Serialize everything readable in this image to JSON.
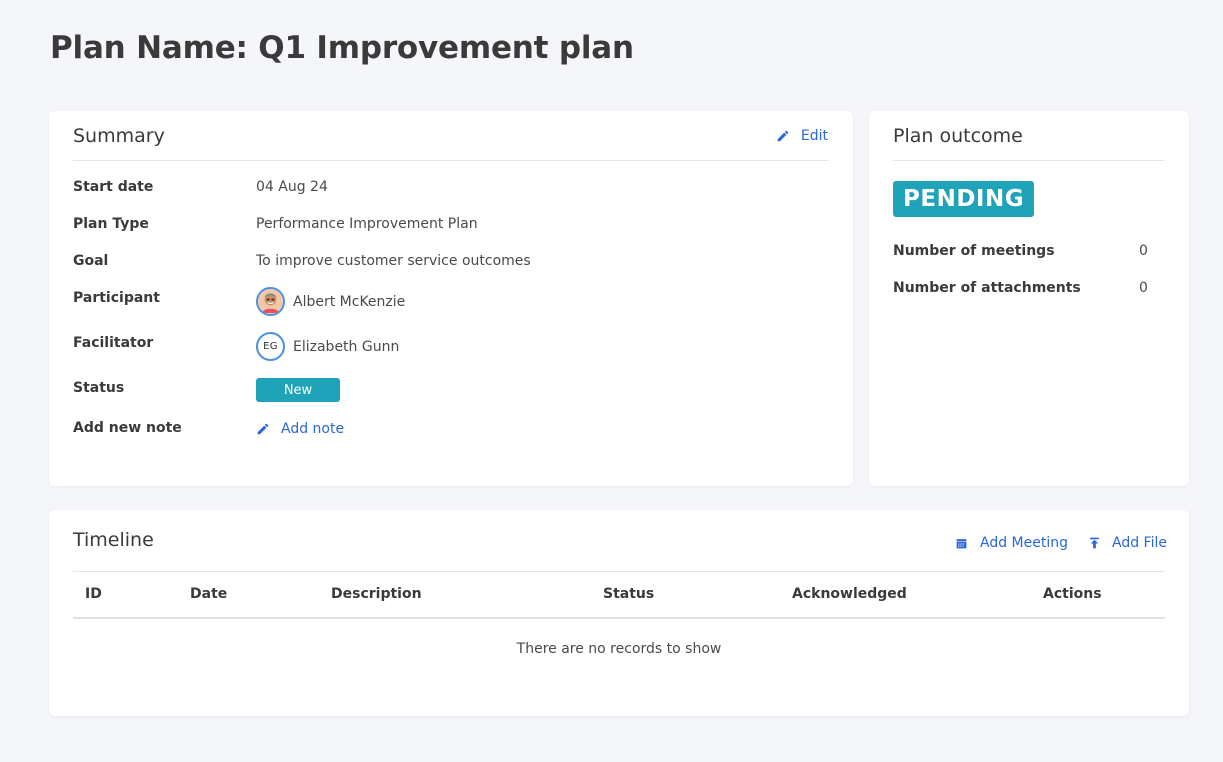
{
  "page": {
    "title": "Plan Name: Q1 Improvement plan"
  },
  "summary": {
    "title": "Summary",
    "edit_label": "Edit",
    "fields": {
      "start_date": {
        "label": "Start date",
        "value": "04 Aug 24"
      },
      "plan_type": {
        "label": "Plan Type",
        "value": "Performance Improvement Plan"
      },
      "goal": {
        "label": "Goal",
        "value": "To improve customer service outcomes"
      },
      "participant": {
        "label": "Participant",
        "name": "Albert McKenzie"
      },
      "facilitator": {
        "label": "Facilitator",
        "name": "Elizabeth Gunn",
        "initials": "EG"
      },
      "status": {
        "label": "Status",
        "value": "New"
      },
      "note": {
        "label": "Add new note",
        "action": "Add note"
      }
    }
  },
  "outcome": {
    "title": "Plan outcome",
    "status": "PENDING",
    "meetings": {
      "label": "Number of meetings",
      "value": "0"
    },
    "attachments": {
      "label": "Number of attachments",
      "value": "0"
    }
  },
  "timeline": {
    "title": "Timeline",
    "add_meeting_label": "Add Meeting",
    "add_file_label": "Add File",
    "columns": [
      "ID",
      "Date",
      "Description",
      "Status",
      "Acknowledged",
      "Actions"
    ],
    "empty_message": "There are no records to show"
  },
  "icons": {
    "edit": "pencil-icon",
    "add_meeting": "calendar-icon",
    "add_file": "upload-icon"
  },
  "colors": {
    "accent": "#1ea3b8",
    "link": "#2a67d6",
    "background": "#f5f6fa"
  }
}
